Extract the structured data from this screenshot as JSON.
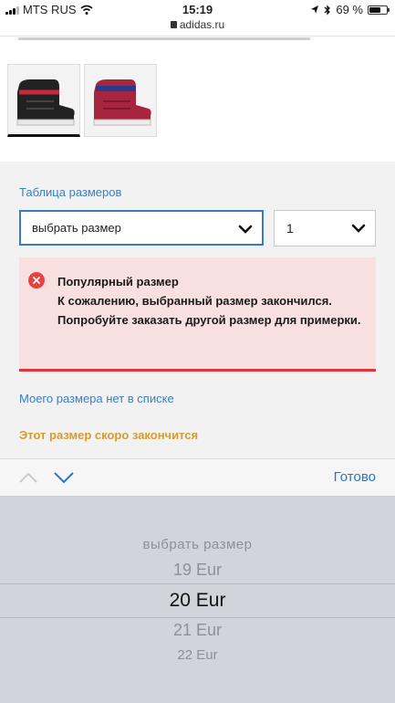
{
  "status_bar": {
    "carrier": "MTS RUS",
    "time": "15:19",
    "url": "adidas.ru",
    "battery": "69 %",
    "battery_level": 0.69
  },
  "product": {
    "thumbnails": [
      {
        "alt": "",
        "selected": true
      },
      {
        "alt": "",
        "selected": false
      }
    ]
  },
  "size_section": {
    "size_chart_link": "Таблица размеров",
    "size_select_value": "выбрать размер",
    "quantity_value": "1"
  },
  "error": {
    "title": "Популярный размер",
    "message": "К сожалению, выбранный размер закончился. Попробуйте заказать другой размер для примерки."
  },
  "links": {
    "no_size": "Моего размера нет в списке",
    "running_out": "Этот размер скоро закончится"
  },
  "toolbar": {
    "done_label": "Готово"
  },
  "picker": {
    "options": [
      "выбрать размер",
      "19 Eur",
      "20 Eur",
      "21 Eur",
      "22 Eur"
    ],
    "selected_index": 2
  },
  "colors": {
    "link": "#3a7ec3",
    "error_accent": "#e0363b",
    "warning": "#d89b2e",
    "select_border": "#3a7bc0"
  }
}
